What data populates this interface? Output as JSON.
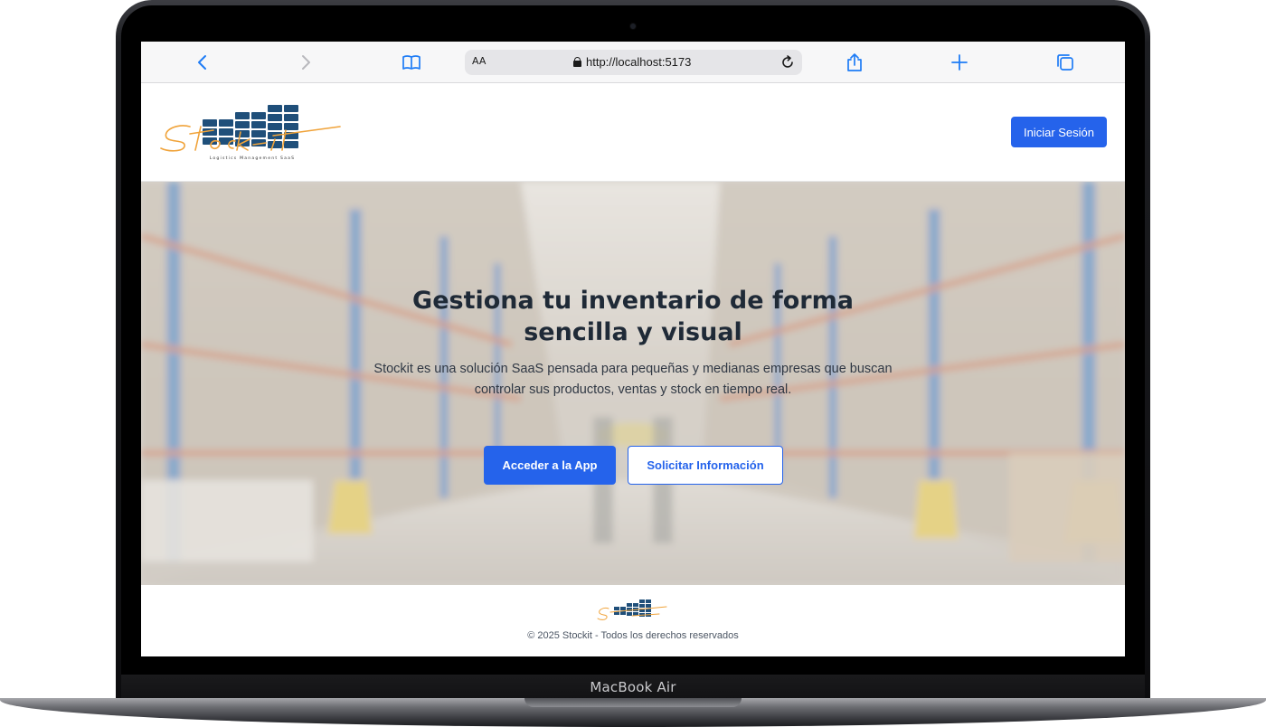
{
  "device": {
    "model": "MacBook Air"
  },
  "browser": {
    "text_size_label": "AA",
    "url": "http://localhost:5173",
    "icons": [
      "back-icon",
      "forward-icon",
      "bookmarks-icon",
      "lock-icon",
      "reload-icon",
      "share-icon",
      "new-tab-icon",
      "tabs-icon"
    ]
  },
  "header": {
    "logo_text": "Stock-it",
    "logo_tagline": "Logistics Management SaaS",
    "login_label": "Iniciar Sesión"
  },
  "hero": {
    "title_line1": "Gestiona tu inventario de forma",
    "title_line2": "sencilla y visual",
    "subtitle": "Stockit es una solución SaaS pensada para pequeñas y medianas empresas que buscan controlar sus productos, ventas y stock en tiempo real.",
    "primary_cta": "Acceder a la App",
    "secondary_cta": "Solicitar Información"
  },
  "footer": {
    "copyright": "© 2025 Stockit - Todos los derechos reservados"
  },
  "colors": {
    "accent": "#2563eb",
    "logo_blue": "#1f4f7a",
    "logo_orange": "#f0a33a",
    "heading": "#1f2a37"
  }
}
